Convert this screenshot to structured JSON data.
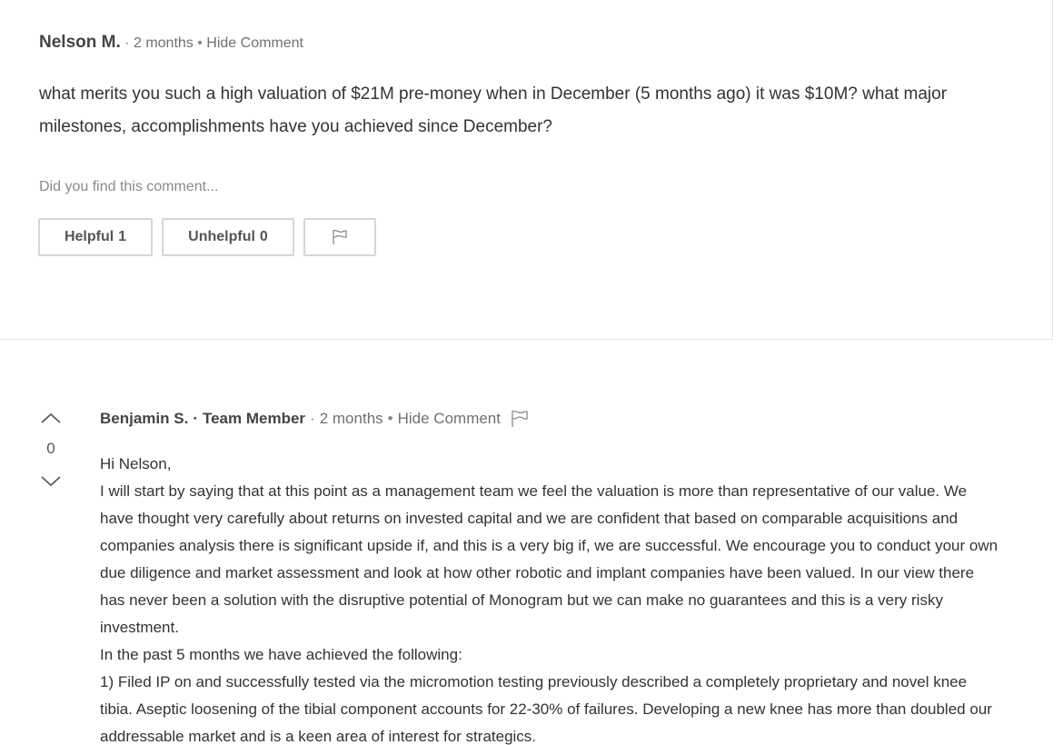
{
  "comment1": {
    "author": "Nelson M.",
    "dot": "·",
    "time": "2 months",
    "bullet": "•",
    "hide": "Hide Comment",
    "body": "what merits you such a high valuation of $21M pre-money when in December (5 months ago) it was $10M? what major milestones, accomplishments have you achieved since December?",
    "prompt": "Did you find this comment...",
    "helpful_label": "Helpful",
    "helpful_count": "1",
    "unhelpful_label": "Unhelpful",
    "unhelpful_count": "0",
    "flag_icon": "flag-icon"
  },
  "comment2": {
    "author": "Benjamin S.",
    "dot": "·",
    "role": "Team Member",
    "time": "2 months",
    "bullet": "•",
    "hide": "Hide Comment",
    "score": "0",
    "icons": [
      "chevron-up-icon",
      "chevron-down-icon",
      "flag-icon"
    ],
    "greeting": "Hi Nelson,",
    "paragraph1": "I will start by saying that at this point as a management team we feel the valuation is more than representative of our value.  We have thought very carefully about returns on invested capital and we are confident that based on comparable acquisitions and companies analysis  there is significant upside if, and this is a very big if, we are successful.  We encourage you to conduct your own due diligence and market assessment and look at how other robotic and implant companies have  been valued.  In our view there has never been a solution with the disruptive potential of Monogram but we can make no guarantees and this is a very risky investment.",
    "paragraph2": "In the past 5 months we have achieved the following:",
    "paragraph3": "1) Filed IP on and successfully tested via the micromotion testing previously described a completely proprietary and novel knee tibia.  Aseptic loosening of the tibial component accounts for 22-30% of failures.  Developing a new knee has more than doubled our addressable market and is a keen area of interest for strategics."
  }
}
